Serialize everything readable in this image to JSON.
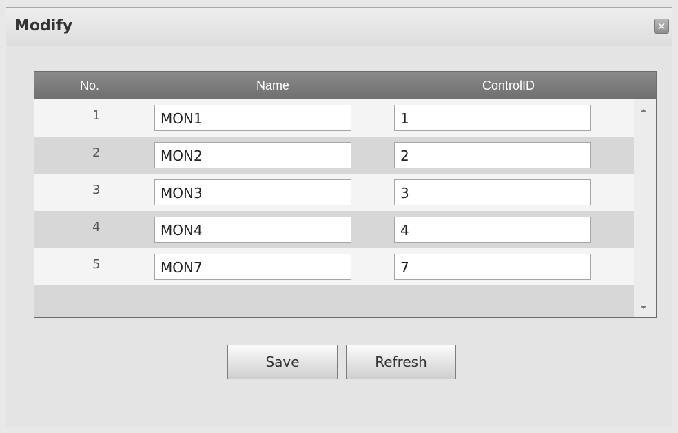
{
  "dialog": {
    "title": "Modify",
    "close_icon": "close-icon",
    "close_glyph": "×"
  },
  "table": {
    "headers": {
      "no": "No.",
      "name": "Name",
      "control_id": "ControlID"
    },
    "rows": [
      {
        "no": "1",
        "name": "MON1",
        "control_id": "1"
      },
      {
        "no": "2",
        "name": "MON2",
        "control_id": "2"
      },
      {
        "no": "3",
        "name": "MON3",
        "control_id": "3"
      },
      {
        "no": "4",
        "name": "MON4",
        "control_id": "4"
      },
      {
        "no": "5",
        "name": "MON7",
        "control_id": "7"
      }
    ]
  },
  "buttons": {
    "save": "Save",
    "refresh": "Refresh"
  }
}
